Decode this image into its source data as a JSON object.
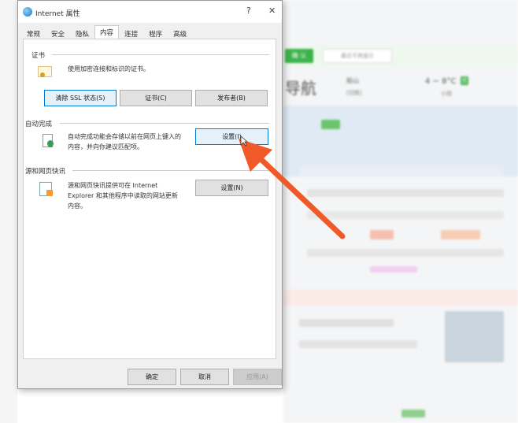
{
  "dialog": {
    "title": "Internet 属性",
    "help": "?",
    "close": "✕",
    "tabs": [
      "常规",
      "安全",
      "隐私",
      "内容",
      "连接",
      "程序",
      "高级"
    ],
    "active_tab": "内容",
    "certificates": {
      "label": "证书",
      "desc": "使用加密连接和标识的证书。",
      "buttons": [
        "清除 SSL 状态(S)",
        "证书(C)",
        "发布者(B)"
      ]
    },
    "autocomplete": {
      "label": "自动完成",
      "desc1": "自动完成功能会存储以前在网页上键入的",
      "desc2": "内容，并向你建议匹配项。",
      "button": "设置(I)"
    },
    "feeds": {
      "label": "源和网页快讯",
      "desc1": "源和网页快讯提供可在 Internet",
      "desc2": "Explorer 和其他程序中读取的网站更新",
      "desc3": "内容。",
      "button": "设置(N)"
    },
    "footer": {
      "ok": "确定",
      "cancel": "取消",
      "apply": "应用(A)"
    }
  },
  "background": {
    "confirm": "确 认",
    "dismiss": "最近不再提示",
    "site": "导航",
    "city": "船山",
    "switch": "[切换]",
    "temp": "4 ~ 8°C",
    "aqi": "优",
    "weather": "小雨"
  },
  "colors": {
    "arrow": "#f05a28",
    "green": "#3cb34a"
  }
}
